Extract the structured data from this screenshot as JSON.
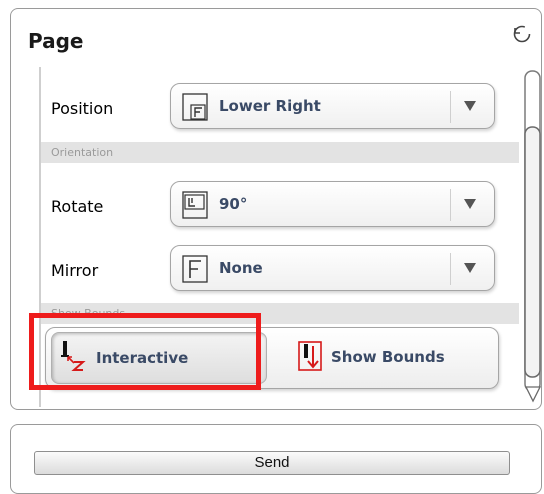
{
  "panel": {
    "title": "Page"
  },
  "rows": {
    "position": {
      "label": "Position",
      "value": "Lower Right"
    },
    "rotate": {
      "label": "Rotate",
      "value": "90°"
    },
    "mirror": {
      "label": "Mirror",
      "value": "None"
    }
  },
  "sections": {
    "orientation": "Orientation",
    "show_bounds": "Show Bounds"
  },
  "bounds_toggle": {
    "interactive_label": "Interactive",
    "show_bounds_label": "Show Bounds",
    "selected": "Interactive"
  },
  "send_label": "Send",
  "colors": {
    "highlight": "#ee1c1c",
    "icon_red": "#d61a1a",
    "value_text": "#3a4a66"
  },
  "icons": [
    "refresh-icon",
    "frame-f-icon",
    "frame-rotated-icon",
    "dropdown-arrow-icon",
    "interactive-cursor-icon",
    "show-bounds-icon"
  ]
}
